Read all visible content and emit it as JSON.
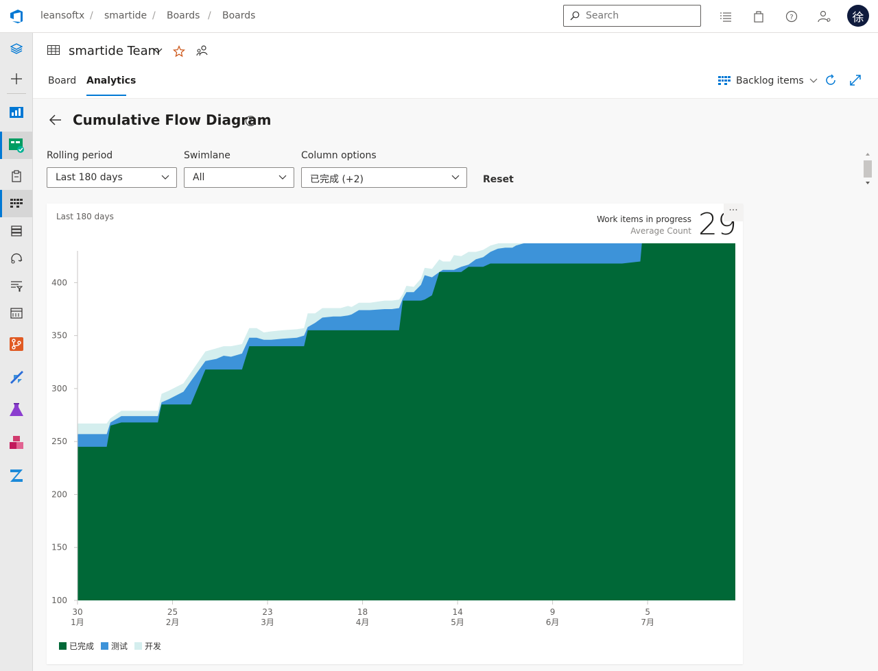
{
  "breadcrumb": [
    "leansoftx",
    "smartide",
    "Boards",
    "Boards"
  ],
  "search": {
    "placeholder": "Search"
  },
  "user": {
    "avatar_text": "徐"
  },
  "team": {
    "name": "smartide Team"
  },
  "tabs": [
    {
      "label": "Board"
    },
    {
      "label": "Analytics"
    }
  ],
  "backlog_picker": {
    "label": "Backlog items"
  },
  "page": {
    "title": "Cumulative Flow Diagram"
  },
  "filters": {
    "rolling_period": {
      "label": "Rolling period",
      "value": "Last 180 days"
    },
    "swimlane": {
      "label": "Swimlane",
      "value": "All"
    },
    "column_options": {
      "label": "Column options",
      "value": "已完成 (+2)"
    },
    "reset_label": "Reset"
  },
  "card": {
    "subtitle": "Last 180 days",
    "kpi_title": "Work items in progress",
    "kpi_subtitle": "Average Count",
    "kpi_value": "29",
    "more": "···"
  },
  "chart_data": {
    "type": "area",
    "stacked": true,
    "ylim": [
      100,
      430
    ],
    "yticks": [
      100,
      150,
      200,
      250,
      300,
      350,
      400
    ],
    "xticks": [
      {
        "day": 0,
        "day_label": "30",
        "month_label": "1月"
      },
      {
        "day": 26,
        "day_label": "25",
        "month_label": "2月"
      },
      {
        "day": 52,
        "day_label": "23",
        "month_label": "3月"
      },
      {
        "day": 78,
        "day_label": "18",
        "month_label": "4月"
      },
      {
        "day": 104,
        "day_label": "14",
        "month_label": "5月"
      },
      {
        "day": 130,
        "day_label": "9",
        "month_label": "6月"
      },
      {
        "day": 156,
        "day_label": "5",
        "month_label": "7月"
      }
    ],
    "x": [
      0,
      8,
      9,
      12,
      22,
      23,
      25,
      29,
      31,
      35,
      38,
      40,
      42,
      45,
      47,
      49,
      51,
      53,
      56,
      60,
      62,
      63,
      65,
      67,
      70,
      72,
      74,
      75,
      77,
      80,
      84,
      86,
      88,
      89,
      90,
      92,
      94,
      95,
      97,
      99,
      100,
      102,
      103,
      105,
      107,
      109,
      110,
      111,
      113,
      115,
      117,
      119,
      120,
      124,
      128,
      129,
      130,
      133,
      134,
      136,
      139,
      141,
      142,
      144,
      146,
      149,
      154,
      155,
      156,
      157,
      158,
      160,
      161,
      162,
      163,
      164,
      165,
      166,
      167,
      168,
      169,
      170,
      171,
      172,
      174,
      176,
      178,
      180
    ],
    "series": [
      {
        "name": "已完成",
        "color": "#006837",
        "values": [
          145,
          145,
          165,
          168,
          168,
          185,
          185,
          185,
          185,
          218,
          218,
          218,
          218,
          218,
          240,
          240,
          240,
          240,
          240,
          240,
          240,
          255,
          255,
          255,
          255,
          255,
          255,
          255,
          255,
          255,
          255,
          255,
          255,
          283,
          283,
          283,
          283,
          284,
          288,
          310,
          310,
          310,
          310,
          310,
          315,
          315,
          315,
          315,
          318,
          318,
          318,
          318,
          318,
          318,
          318,
          318,
          318,
          318,
          318,
          318,
          318,
          318,
          318,
          318,
          318,
          318,
          320,
          360,
          360,
          360,
          360,
          360,
          360,
          360,
          360,
          360,
          360,
          360,
          360,
          360,
          360,
          360,
          360,
          360,
          360,
          360,
          360,
          360
        ]
      },
      {
        "name": "测试",
        "color": "#3d93d9",
        "values": [
          12,
          12,
          3,
          6,
          6,
          2,
          5,
          12,
          22,
          8,
          10,
          13,
          12,
          15,
          8,
          8,
          6,
          6,
          7,
          8,
          10,
          3,
          7,
          12,
          13,
          13,
          14,
          15,
          19,
          19,
          20,
          20,
          21,
          2,
          8,
          8,
          15,
          23,
          17,
          0,
          2,
          2,
          2,
          5,
          2,
          7,
          8,
          9,
          11,
          14,
          15,
          15,
          17,
          21,
          21,
          22,
          22,
          26,
          28,
          34,
          40,
          40,
          40,
          40,
          40,
          40,
          40,
          10,
          7,
          3,
          5,
          9,
          7,
          9,
          13,
          20,
          20,
          23,
          25,
          31,
          32,
          35,
          35,
          37,
          45,
          47,
          47,
          49
        ]
      },
      {
        "name": "开发",
        "color": "#d4eeee",
        "values": [
          10,
          10,
          4,
          5,
          5,
          8,
          8,
          8,
          8,
          9,
          10,
          9,
          10,
          9,
          9,
          9,
          7,
          8,
          8,
          8,
          7,
          13,
          9,
          9,
          8,
          8,
          9,
          7,
          7,
          7,
          8,
          8,
          8,
          4,
          6,
          5,
          6,
          7,
          8,
          12,
          8,
          8,
          14,
          10,
          12,
          7,
          7,
          7,
          6,
          5,
          6,
          7,
          8,
          7,
          8,
          8,
          7,
          7,
          7,
          7,
          6,
          6,
          6,
          7,
          8,
          8,
          8,
          8,
          10,
          15,
          13,
          11,
          13,
          12,
          9,
          7,
          7,
          7,
          8,
          7,
          7,
          5,
          7,
          10,
          7,
          7,
          10,
          13
        ]
      }
    ]
  }
}
